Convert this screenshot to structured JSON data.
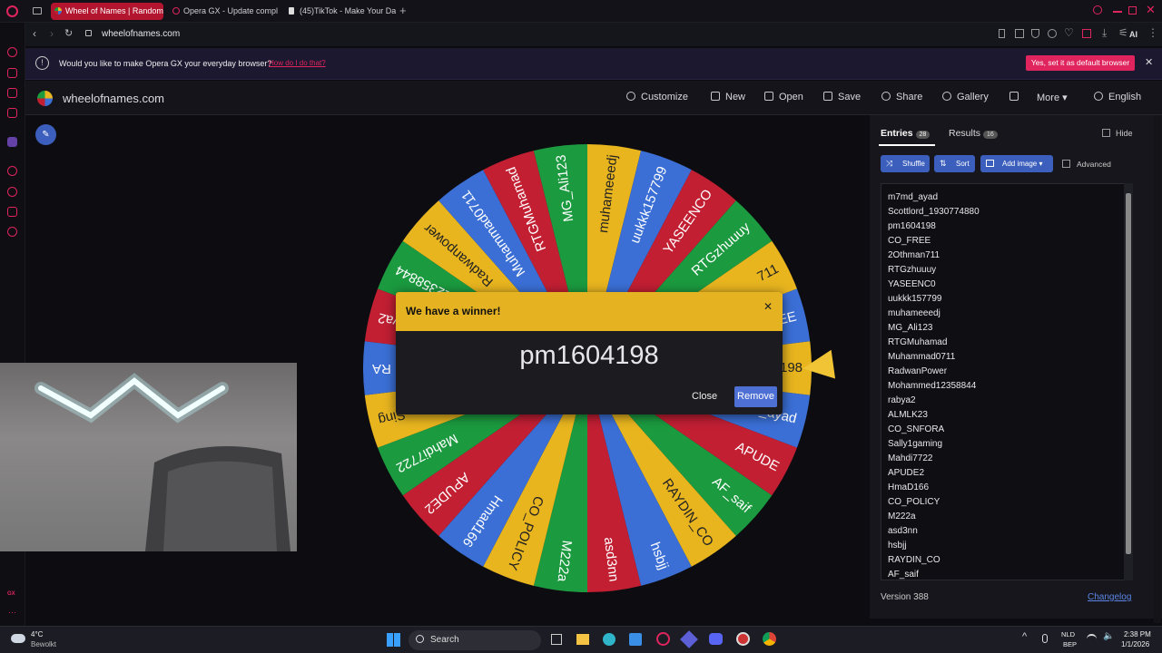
{
  "browser": {
    "tabs": [
      {
        "label": "Wheel of Names | Random",
        "active": true
      },
      {
        "label": "Opera GX - Update compl",
        "active": false
      },
      {
        "label": "(45)TikTok - Make Your Da",
        "active": false
      }
    ],
    "url": "wheelofnames.com",
    "infobar": {
      "message": "Would you like to make Opera GX your everyday browser?",
      "link": "How do I do that?",
      "button": "Yes, set it as default browser"
    },
    "ai_label": "AI"
  },
  "site": {
    "brand": "wheelofnames.com",
    "nav": [
      "Customize",
      "New",
      "Open",
      "Save",
      "Share",
      "Gallery",
      "More",
      "English"
    ],
    "panel": {
      "entries_tab": "Entries",
      "entries_count": "28",
      "results_tab": "Results",
      "results_count": "16",
      "hide_label": "Hide",
      "shuffle": "Shuffle",
      "sort": "Sort",
      "add_image": "Add image",
      "advanced": "Advanced",
      "version": "Version 388",
      "changelog": "Changelog"
    },
    "entries": [
      "m7md_ayad",
      "Scottlord_1930774880",
      "pm1604198",
      "CO_FREE",
      "2Othman711",
      "RTGzhuuuy",
      "YASEENC0",
      "uukkk157799",
      "muhameeedj",
      "MG_Ali123",
      "RTGMuhamad",
      "Muhammad0711",
      "RadwanPower",
      "Mohammed12358844",
      "rabya2",
      "ALMLK23",
      "CO_SNFORA",
      "Sally1gaming",
      "Mahdi7722",
      "APUDE2",
      "HmaD166",
      "CO_POLICY",
      "M222a",
      "asd3nn",
      "hsbjj",
      "RAYDIN_CO",
      "AF_saif"
    ],
    "wheel": {
      "segments": [
        "pm1604198",
        "m7md_ayad",
        "APUDE",
        "AF_saif",
        "RAYDIN_CO",
        "hsbjj",
        "asd3nn",
        "M222a",
        "CO_POLICY",
        "Hmad166",
        "APUDE2",
        "Mahdi7722",
        "Sing",
        "RA",
        "rabya2",
        "Mohammed12358844",
        "Radwanpower",
        "Muhammad0711",
        "RTGMuhamad",
        "MG_Ali123",
        "muhameeedj",
        "uukkk157799",
        "YASEENCO",
        "RTGzhuuuy",
        "711",
        "FREE"
      ],
      "colors": [
        "#e8b51f",
        "#3b6fd6",
        "#c21f33",
        "#1b9a3f"
      ]
    },
    "dialog": {
      "title": "We have a winner!",
      "winner": "pm1604198",
      "close": "Close",
      "remove": "Remove"
    }
  },
  "taskbar": {
    "weather_temp": "4°C",
    "weather_desc": "Bewolkt",
    "search": "Search",
    "lang1": "NLD",
    "lang2": "BEP",
    "time": "2:38 PM",
    "date": "1/1/2026"
  }
}
